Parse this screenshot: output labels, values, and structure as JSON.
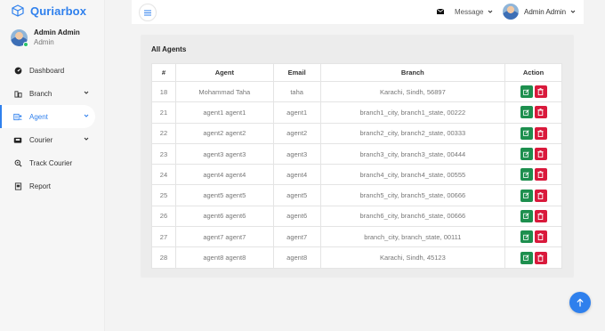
{
  "brand": {
    "name": "Quriarbox",
    "accent": "#2f80ed"
  },
  "user": {
    "name": "Admin Admin",
    "role": "Admin"
  },
  "nav": [
    {
      "label": "Dashboard",
      "icon": "dashboard-icon",
      "expandable": false,
      "active": false
    },
    {
      "label": "Branch",
      "icon": "branch-icon",
      "expandable": true,
      "active": false
    },
    {
      "label": "Agent",
      "icon": "agent-icon",
      "expandable": true,
      "active": true
    },
    {
      "label": "Courier",
      "icon": "courier-icon",
      "expandable": true,
      "active": false
    },
    {
      "label": "Track Courier",
      "icon": "track-icon",
      "expandable": false,
      "active": false
    },
    {
      "label": "Report",
      "icon": "report-icon",
      "expandable": false,
      "active": false
    }
  ],
  "topbar": {
    "message_label": "Message",
    "user_name": "Admin Admin"
  },
  "agents": {
    "title": "All Agents",
    "columns": [
      "#",
      "Agent",
      "Email",
      "Branch",
      "Action"
    ],
    "rows": [
      {
        "id": "18",
        "agent": "Mohammad Taha",
        "email": "taha",
        "branch": "Karachi, Sindh, 56897"
      },
      {
        "id": "21",
        "agent": "agent1 agent1",
        "email": "agent1",
        "branch": "branch1_city, branch1_state, 00222"
      },
      {
        "id": "22",
        "agent": "agent2 agent2",
        "email": "agent2",
        "branch": "branch2_city, branch2_state, 00333"
      },
      {
        "id": "23",
        "agent": "agent3 agent3",
        "email": "agent3",
        "branch": "branch3_city, branch3_state, 00444"
      },
      {
        "id": "24",
        "agent": "agent4 agent4",
        "email": "agent4",
        "branch": "branch4_city, branch4_state, 00555"
      },
      {
        "id": "25",
        "agent": "agent5 agent5",
        "email": "agent5",
        "branch": "branch5_city, branch5_state, 00666"
      },
      {
        "id": "26",
        "agent": "agent6 agent6",
        "email": "agent6",
        "branch": "branch6_city, branch6_state, 00666"
      },
      {
        "id": "27",
        "agent": "agent7 agent7",
        "email": "agent7",
        "branch": "branch_city, branch_state, 00111"
      },
      {
        "id": "28",
        "agent": "agent8 agent8",
        "email": "agent8",
        "branch": "Karachi, Sindh, 45123"
      }
    ],
    "edit_color": "#1d8f4e",
    "delete_color": "#d91a3c"
  }
}
